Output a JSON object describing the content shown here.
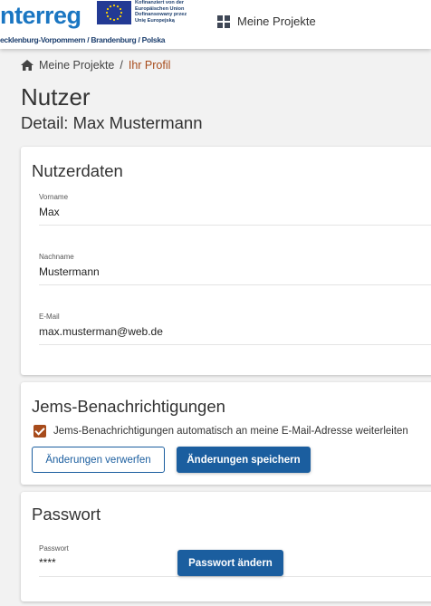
{
  "header": {
    "logo_word": "nterreg",
    "logo_region": "ecklenburg-Vorpommern / Brandenburg / Polska",
    "eu_text": [
      "Kofinanziert von der",
      "Europäischen Union",
      "Dofinansowany przez",
      "Unię Europejską"
    ],
    "nav_label": "Meine Projekte",
    "nav_icon": "dashboard-icon"
  },
  "breadcrumb": {
    "home_icon": "home-icon",
    "item": "Meine Projekte",
    "separator": "/",
    "current": "Ihr Profil"
  },
  "page": {
    "title": "Nutzer",
    "subtitle": "Detail: Max Mustermann"
  },
  "user_data": {
    "title": "Nutzerdaten",
    "fields": [
      {
        "label": "Vorname",
        "value": "Max"
      },
      {
        "label": "Nachname",
        "value": "Mustermann"
      },
      {
        "label": "E-Mail",
        "value": "max.musterman@web.de"
      }
    ]
  },
  "notifications": {
    "title": "Jems-Benachrichtigungen",
    "checkbox_label": "Jems-Benachrichtigungen automatisch an meine E-Mail-Adresse weiterleiten",
    "checked": true,
    "discard_label": "Änderungen verwerfen",
    "save_label": "Änderungen speichern"
  },
  "password": {
    "title": "Passwort",
    "field_label": "Passwort",
    "field_value": "****",
    "change_label": "Passwort ändern"
  },
  "colors": {
    "primary": "#1b5e9f",
    "accent": "#a74b1b",
    "background": "#f2f2f2"
  }
}
